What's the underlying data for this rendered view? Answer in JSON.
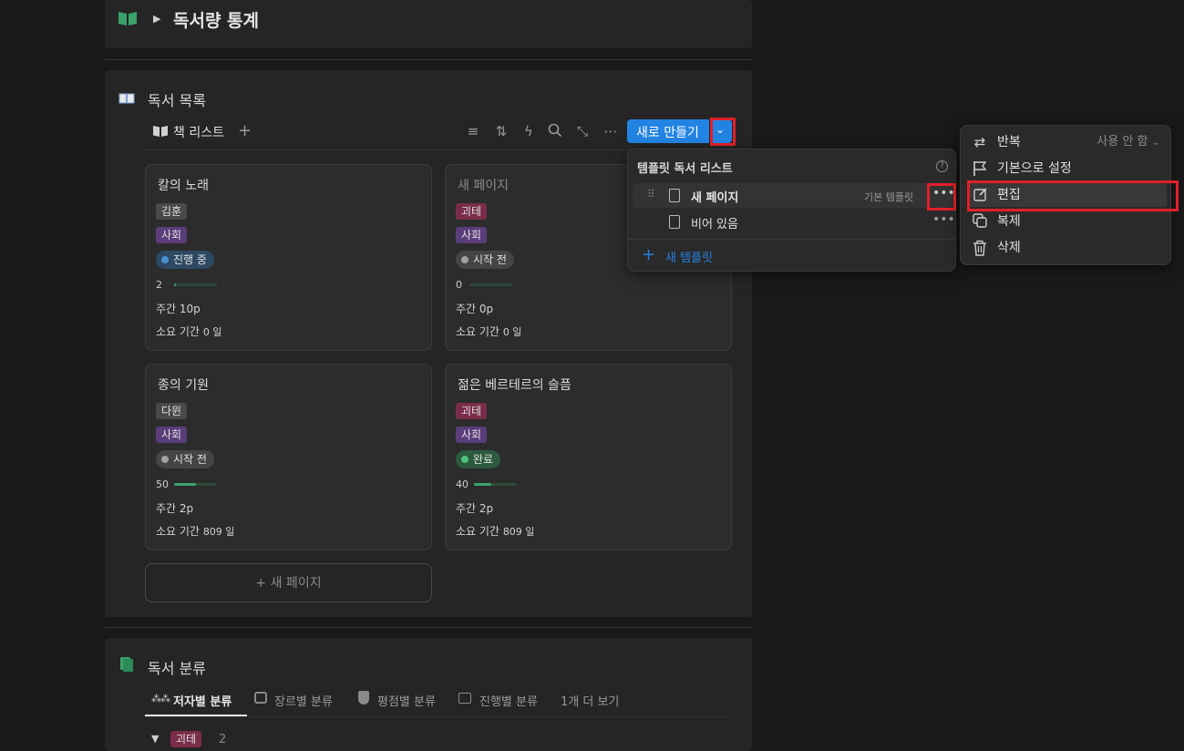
{
  "page": {
    "title": "독서량 통계",
    "title_icon": "book-open-icon"
  },
  "reading_list": {
    "section_title": "독서 목록",
    "view_tab": "책 리스트",
    "new_button": "새로 만들기",
    "cards": [
      {
        "title": "칼의 노래",
        "author": "김훈",
        "genre": "사회",
        "status": "진행 중",
        "status_color": "#4a8fd0",
        "progress": "2",
        "progress_fraction": 0.04,
        "weekly": "주간 10p",
        "duration_label": "소요 기간",
        "duration_value": "0 일"
      },
      {
        "title": "새 페이지",
        "author": "괴테",
        "genre": "사회",
        "status": "시작 전",
        "status_color": "#a0a0a0",
        "progress": "0",
        "progress_fraction": 0.0,
        "weekly": "주간 0p",
        "duration_label": "소요 기간",
        "duration_value": "0 일"
      },
      {
        "title": "종의 기원",
        "author": "다윈",
        "genre": "사회",
        "status": "시작 전",
        "status_color": "#a0a0a0",
        "progress": "50",
        "progress_fraction": 0.5,
        "weekly": "주간 2p",
        "duration_label": "소요 기간",
        "duration_value": "809 일"
      },
      {
        "title": "젊은 베르테르의 슬픔",
        "author": "괴테",
        "genre": "사회",
        "status": "완료",
        "status_color": "#4fc37a",
        "progress": "40",
        "progress_fraction": 0.4,
        "weekly": "주간 2p",
        "duration_label": "소요 기간",
        "duration_value": "809 일"
      }
    ],
    "add_page": "+ 새 페이지"
  },
  "template_menu": {
    "title": "템플릿 독서 리스트",
    "items": [
      {
        "label": "새 페이지",
        "badge": "기본 템플릿"
      },
      {
        "label": "비어 있음",
        "badge": ""
      }
    ],
    "new_template": "새 템플릿"
  },
  "context_menu": {
    "items": [
      {
        "label": "반복",
        "value": "사용 안 함",
        "icon": "repeat-icon"
      },
      {
        "label": "기본으로 설정",
        "icon": "flag-icon"
      },
      {
        "label": "편집",
        "icon": "edit-icon"
      },
      {
        "label": "복제",
        "icon": "duplicate-icon"
      },
      {
        "label": "삭제",
        "icon": "trash-icon"
      }
    ]
  },
  "classification": {
    "section_title": "독서 분류",
    "tabs": [
      "저자별 분류",
      "장르별 분류",
      "평점별 분류",
      "진행별 분류",
      "1개 더 보기"
    ],
    "group_label": "괴테",
    "group_count": "2"
  },
  "colors": {
    "accent_blue": "#2383e2",
    "highlight_red": "#e0202a",
    "green_icon": "#3aa36a"
  }
}
